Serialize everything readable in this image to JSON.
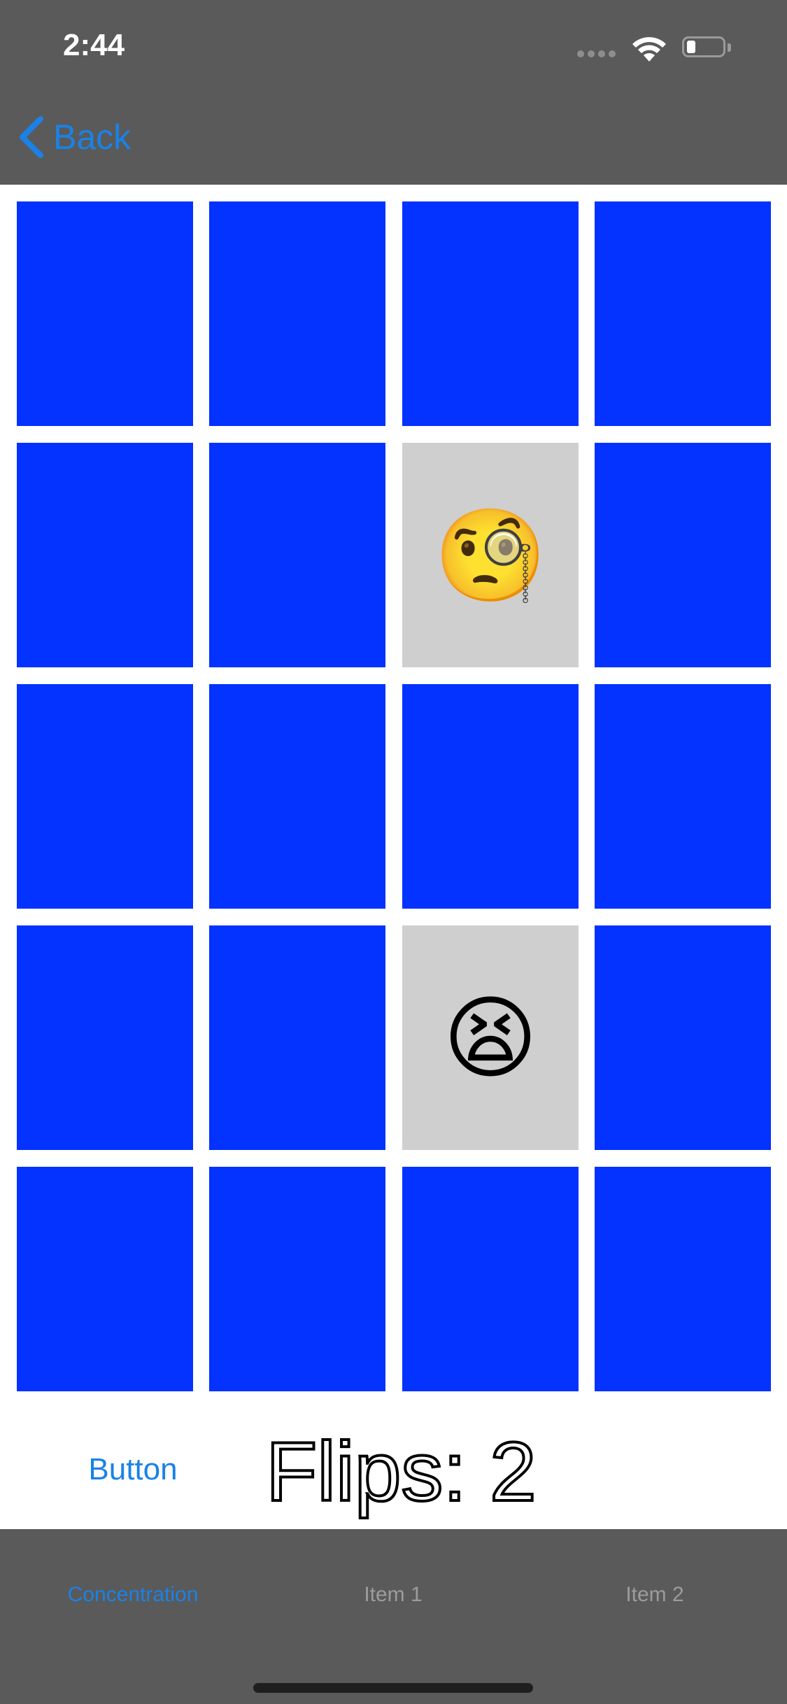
{
  "status_bar": {
    "time": "2:44",
    "icons": [
      "cellular-signal-icon",
      "wifi-icon",
      "battery-icon"
    ]
  },
  "nav": {
    "back_label": "Back",
    "back_icon": "chevron-left-icon"
  },
  "colors": {
    "bar_background": "#5a5a5a",
    "card_back": "#0432ff",
    "card_face": "#cfcfcf",
    "accent": "#1a82e6",
    "tab_inactive": "#9c9c9c"
  },
  "cards": [
    {
      "row": 1,
      "col": 1,
      "face_up": false,
      "emoji": ""
    },
    {
      "row": 1,
      "col": 2,
      "face_up": false,
      "emoji": ""
    },
    {
      "row": 1,
      "col": 3,
      "face_up": false,
      "emoji": ""
    },
    {
      "row": 1,
      "col": 4,
      "face_up": false,
      "emoji": ""
    },
    {
      "row": 2,
      "col": 1,
      "face_up": false,
      "emoji": ""
    },
    {
      "row": 2,
      "col": 2,
      "face_up": false,
      "emoji": ""
    },
    {
      "row": 2,
      "col": 3,
      "face_up": true,
      "emoji": "🧐"
    },
    {
      "row": 2,
      "col": 4,
      "face_up": false,
      "emoji": ""
    },
    {
      "row": 3,
      "col": 1,
      "face_up": false,
      "emoji": ""
    },
    {
      "row": 3,
      "col": 2,
      "face_up": false,
      "emoji": ""
    },
    {
      "row": 3,
      "col": 3,
      "face_up": false,
      "emoji": ""
    },
    {
      "row": 3,
      "col": 4,
      "face_up": false,
      "emoji": ""
    },
    {
      "row": 4,
      "col": 1,
      "face_up": false,
      "emoji": ""
    },
    {
      "row": 4,
      "col": 2,
      "face_up": false,
      "emoji": ""
    },
    {
      "row": 4,
      "col": 3,
      "face_up": true,
      "emoji": "😫"
    },
    {
      "row": 4,
      "col": 4,
      "face_up": false,
      "emoji": ""
    },
    {
      "row": 5,
      "col": 1,
      "face_up": false,
      "emoji": ""
    },
    {
      "row": 5,
      "col": 2,
      "face_up": false,
      "emoji": ""
    },
    {
      "row": 5,
      "col": 3,
      "face_up": false,
      "emoji": ""
    },
    {
      "row": 5,
      "col": 4,
      "face_up": false,
      "emoji": ""
    }
  ],
  "controls": {
    "button_label": "Button",
    "flips_label": "Flips: 2"
  },
  "tab_bar": {
    "tabs": [
      {
        "label": "Concentration",
        "selected": true
      },
      {
        "label": "Item 1",
        "selected": false
      },
      {
        "label": "Item 2",
        "selected": false
      }
    ]
  }
}
